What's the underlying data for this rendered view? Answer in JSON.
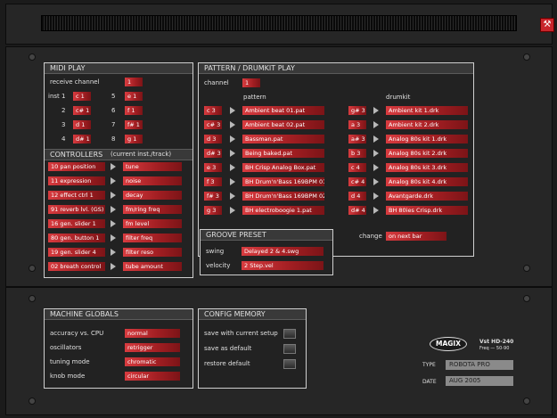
{
  "midi_play": {
    "title": "MIDI PLAY",
    "receive_channel_label": "receive channel",
    "receive_channel_value": "1",
    "instruments": [
      {
        "label": "inst 1",
        "value": "c 1"
      },
      {
        "label": "2",
        "value": "c# 1"
      },
      {
        "label": "3",
        "value": "d 1"
      },
      {
        "label": "4",
        "value": "d# 1"
      },
      {
        "label": "5",
        "value": "e 1"
      },
      {
        "label": "6",
        "value": "f 1"
      },
      {
        "label": "7",
        "value": "f# 1"
      },
      {
        "label": "8",
        "value": "g 1"
      }
    ]
  },
  "controllers": {
    "title": "CONTROLLERS",
    "subtitle": "(current inst./track)",
    "rows": [
      {
        "source": "10 pan position",
        "target": "tune"
      },
      {
        "source": "11 expression",
        "target": "noise"
      },
      {
        "source": "12 effect ctrl 1",
        "target": "decay"
      },
      {
        "source": "91 reverb lvl. (GS)",
        "target": "fm/ring freq"
      },
      {
        "source": "16 gen. slider 1",
        "target": "fm level"
      },
      {
        "source": "80 gen. button 1",
        "target": "filter freq"
      },
      {
        "source": "19 gen. slider 4",
        "target": "filter reso"
      },
      {
        "source": "02 breath control",
        "target": "tube amount"
      }
    ]
  },
  "pattern_play": {
    "title": "PATTERN / DRUMKIT PLAY",
    "channel_label": "channel",
    "channel_value": "1",
    "pattern_header": "pattern",
    "drumkit_header": "drumkit",
    "patterns": [
      {
        "note": "c 3",
        "name": "Ambient beat 01.pat"
      },
      {
        "note": "c# 3",
        "name": "Ambient beat 02.pat"
      },
      {
        "note": "d 3",
        "name": "Bassman.pat"
      },
      {
        "note": "d# 3",
        "name": "Being baked.pat"
      },
      {
        "note": "e 3",
        "name": "BH Crisp Analog Box.pat"
      },
      {
        "note": "f 3",
        "name": "BH Drum'n'Bass 169BPM 01"
      },
      {
        "note": "f# 3",
        "name": "BH Drum'n'Bass 169BPM 02"
      },
      {
        "note": "g 3",
        "name": "BH electroboogie 1.pat"
      }
    ],
    "drumkits": [
      {
        "note": "g# 3",
        "name": "Ambient kit 1.drk"
      },
      {
        "note": "a 3",
        "name": "Ambient kit 2.drk"
      },
      {
        "note": "a# 3",
        "name": "Analog 80s kit 1.drk"
      },
      {
        "note": "b 3",
        "name": "Analog 80s kit 2.drk"
      },
      {
        "note": "c 4",
        "name": "Analog 80s kit 3.drk"
      },
      {
        "note": "c# 4",
        "name": "Analog 80s kit 4.drk"
      },
      {
        "note": "d 4",
        "name": "Avantgarde.drk"
      },
      {
        "note": "d# 4",
        "name": "BH 80ies Crisp.drk"
      }
    ],
    "change_label": "change",
    "change_value": "on next bar"
  },
  "groove_preset": {
    "title": "GROOVE PRESET",
    "swing_label": "swing",
    "swing_value": "Delayed 2 & 4.swg",
    "velocity_label": "velocity",
    "velocity_value": "2 Step.vel"
  },
  "machine_globals": {
    "title": "MACHINE GLOBALS",
    "rows": [
      {
        "label": "accuracy vs. CPU",
        "value": "normal"
      },
      {
        "label": "oscillators",
        "value": "retrigger"
      },
      {
        "label": "tuning mode",
        "value": "chromatic"
      },
      {
        "label": "knob mode",
        "value": "circular"
      }
    ]
  },
  "config_memory": {
    "title": "CONFIG MEMORY",
    "rows": [
      {
        "label": "save with current setup"
      },
      {
        "label": "save as default"
      },
      {
        "label": "restore default"
      }
    ]
  },
  "badge": {
    "brand": "MAGIX",
    "vst": "Vst HD-240",
    "freq": "Freq — 50-90",
    "type_label": "TYPE",
    "type_value": "ROBOTA PRO",
    "date_label": "DATE",
    "date_value": "AUG 2005"
  },
  "colors": {
    "accent_red": "#c8242b",
    "panel_border": "#cfcfcf",
    "background": "#1b1b1b"
  }
}
